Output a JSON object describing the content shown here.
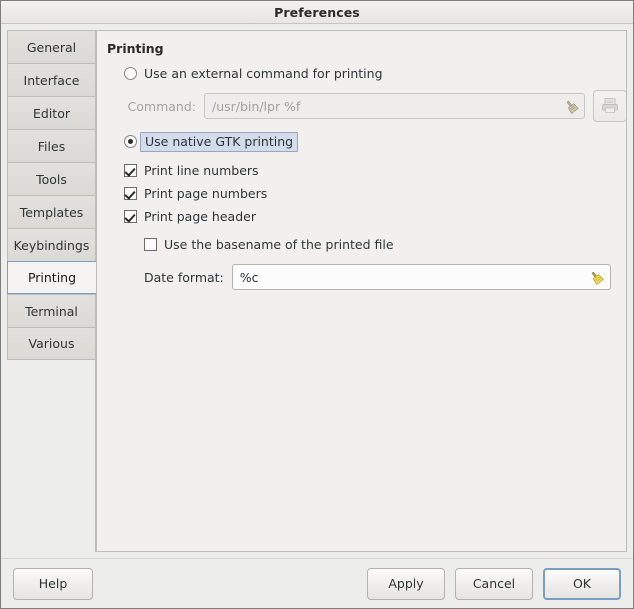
{
  "window": {
    "title": "Preferences"
  },
  "sidebar": {
    "items": [
      {
        "label": "General",
        "selected": false
      },
      {
        "label": "Interface",
        "selected": false
      },
      {
        "label": "Editor",
        "selected": false
      },
      {
        "label": "Files",
        "selected": false
      },
      {
        "label": "Tools",
        "selected": false
      },
      {
        "label": "Templates",
        "selected": false
      },
      {
        "label": "Keybindings",
        "selected": false
      },
      {
        "label": "Printing",
        "selected": true
      },
      {
        "label": "Terminal",
        "selected": false
      },
      {
        "label": "Various",
        "selected": false
      }
    ]
  },
  "page": {
    "section_title": "Printing",
    "external_radio": {
      "label": "Use an external command for printing",
      "checked": false,
      "focused": false
    },
    "command": {
      "label": "Command:",
      "value": "/usr/bin/lpr %f",
      "disabled": true,
      "clear_icon": "broom-clear-icon"
    },
    "printer_button": {
      "icon": "printer-icon",
      "disabled": true
    },
    "native_radio": {
      "label": "Use native GTK printing",
      "checked": true,
      "focused": true
    },
    "checkboxes": [
      {
        "label": "Print line numbers",
        "checked": true,
        "indent": 0
      },
      {
        "label": "Print page numbers",
        "checked": true,
        "indent": 0
      },
      {
        "label": "Print page header",
        "checked": true,
        "indent": 0
      },
      {
        "label": "Use the basename of the printed file",
        "checked": false,
        "indent": 1
      }
    ],
    "date_format": {
      "label": "Date format:",
      "value": "%c",
      "clear_icon": "broom-clear-icon"
    }
  },
  "actions": {
    "help": "Help",
    "apply": "Apply",
    "cancel": "Cancel",
    "ok": "OK",
    "default_focus": "ok"
  },
  "colors": {
    "window_bg": "#ededeb",
    "page_bg": "#f1f0ee",
    "tab_bg": "#dedcd8",
    "tab_selected_bg": "#f4f3f2",
    "focus_blue": "#7a9dc4",
    "focus_label_bg": "#d3dcea",
    "text": "#2e3436",
    "disabled_text": "#a3a19c",
    "broom_yellow": "#e8d44a"
  }
}
